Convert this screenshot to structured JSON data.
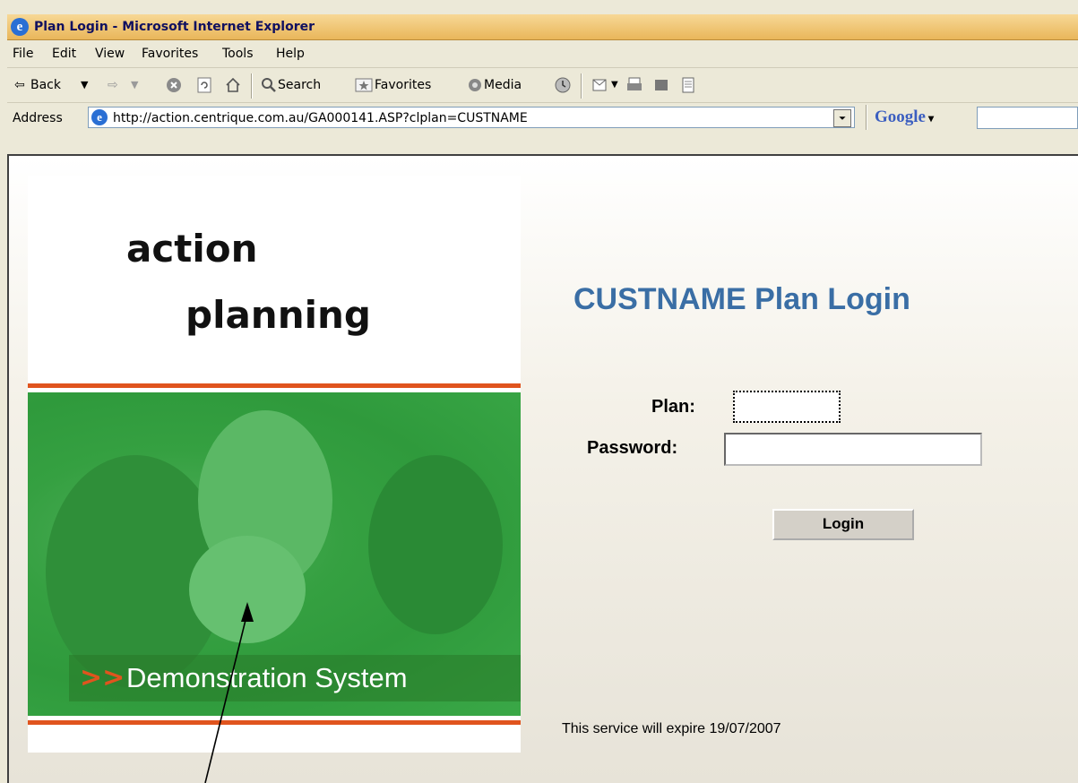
{
  "window": {
    "title": "Plan Login - Microsoft Internet Explorer",
    "title_bar_color": "#e9b65a"
  },
  "menu": [
    "File",
    "Edit",
    "View",
    "Favorites",
    "Tools",
    "Help"
  ],
  "toolbar": {
    "back_label": "Back",
    "search_label": "Search",
    "favorites_label": "Favorites",
    "media_label": "Media"
  },
  "address": {
    "label": "Address",
    "url": "http://action.centrique.com.au/GA000141.ASP?clplan=CUSTNAME",
    "google_logo": "Google"
  },
  "banner": {
    "logo_line1": "action",
    "logo_line2": "planning",
    "arrows": ">>",
    "caption": "Demonstration System",
    "photo_color": "#35a041",
    "accent_color": "#e0541e"
  },
  "login": {
    "title": "CUSTNAME Plan Login",
    "title_color": "#3a6ea5",
    "plan_label": "Plan:",
    "plan_value": "",
    "password_label": "Password:",
    "password_value": "",
    "button_label": "Login",
    "expiry_text": "This service will expire 19/07/2007"
  }
}
